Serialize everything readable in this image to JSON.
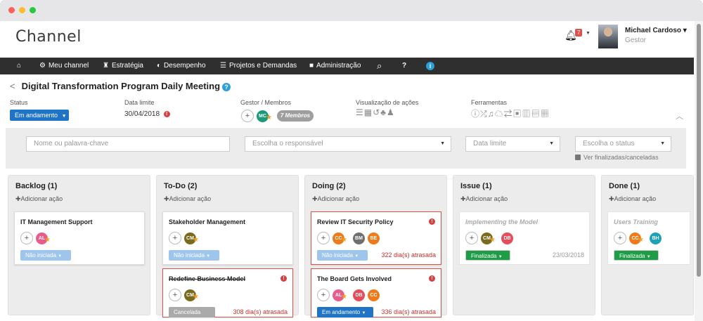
{
  "app": {
    "name": "Channel"
  },
  "user": {
    "name": "Michael Cardoso",
    "role": "Gestor",
    "notifications": "7"
  },
  "nav": {
    "home": "⌂",
    "items": [
      "Meu channel",
      "Estratégia",
      "Desempenho",
      "Projetos e Demandas",
      "Administração"
    ],
    "search": "⌕",
    "help": "?",
    "info": "i"
  },
  "meeting": {
    "title": "Digital Transformation Program Daily Meeting",
    "status_label": "Status",
    "status_value": "Em andamento",
    "deadline_label": "Data limite",
    "deadline_value": "30/04/2018",
    "manager_label": "Gestor / Membros",
    "manager_initials": "MC",
    "members_pill": "7 Membros",
    "view_label": "Visualização de ações",
    "tools_label": "Ferramentas"
  },
  "filters": {
    "keyword_placeholder": "Nome ou palavra-chave",
    "responsible_placeholder": "Escolha o responsável",
    "deadline_placeholder": "Data limite",
    "status_placeholder": "Escolha o status",
    "show_finished": "Ver finalizadas/canceladas"
  },
  "columns": [
    {
      "title": "Backlog (1)",
      "add": "Adicionar ação",
      "cards": [
        {
          "title": "IT Management Support",
          "avatars": [
            "AL"
          ],
          "state": "Não iniciada"
        }
      ]
    },
    {
      "title": "To-Do (2)",
      "add": "Adicionar ação",
      "cards": [
        {
          "title": "Stakeholder Management",
          "avatars": [
            "CM"
          ],
          "state": "Não iniciada"
        },
        {
          "title": "Redefine Business Model",
          "avatars": [
            "CM"
          ],
          "state": "Cancelada",
          "late": "308 dia(s) atrasada"
        }
      ]
    },
    {
      "title": "Doing (2)",
      "add": "Adicionar ação",
      "cards": [
        {
          "title": "Review IT Security Policy",
          "avatars": [
            "CC",
            "BM",
            "BE"
          ],
          "state": "Não iniciada",
          "late": "322 dia(s) atrasada"
        },
        {
          "title": "The Board Gets Involved",
          "avatars": [
            "AL",
            "DB",
            "CC"
          ],
          "state": "Em andamento",
          "late": "336 dia(s) atrasada"
        }
      ]
    },
    {
      "title": "Issue (1)",
      "add": "Adicionar ação",
      "cards": [
        {
          "title": "Implementing the Model",
          "avatars": [
            "CM",
            "DB"
          ],
          "state": "Finalizada",
          "date": "23/03/2018"
        }
      ]
    },
    {
      "title": "Done (1)",
      "add": "Adicionar ação",
      "cards": [
        {
          "title": "Users Training",
          "avatars": [
            "CC",
            "BH"
          ],
          "state": "Finalizada"
        }
      ]
    }
  ],
  "colors": {
    "navbar": "#2f2f2f",
    "primary": "#1f74c8",
    "success": "#1f9d46",
    "danger": "#d9534f",
    "avatar_AL": "#e85c8a",
    "avatar_CM": "#7a6a1e",
    "avatar_CC": "#ee7a1a",
    "avatar_BM": "#6f6f6f",
    "avatar_BE": "#ee7a1a",
    "avatar_DB": "#e84c5a",
    "avatar_BH": "#1aa3b8",
    "avatar_MC": "#1a9a7a"
  }
}
